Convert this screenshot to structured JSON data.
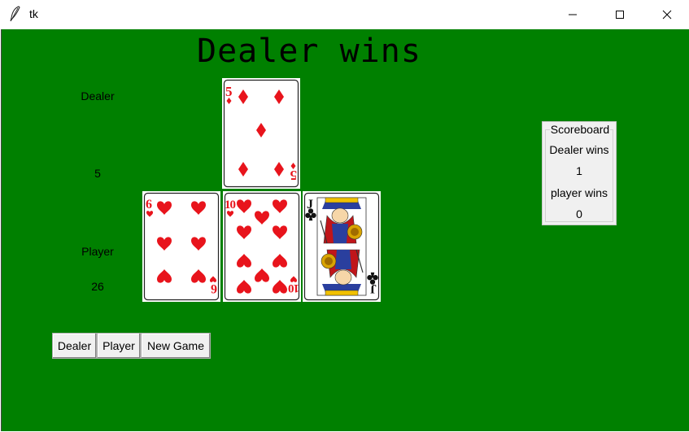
{
  "window": {
    "title": "tk"
  },
  "result_text": "Dealer wins",
  "labels": {
    "dealer": "Dealer",
    "dealer_score": "5",
    "player": "Player",
    "player_score": "26"
  },
  "buttons": {
    "dealer": "Dealer",
    "player": "Player",
    "new_game": "New Game"
  },
  "scoreboard": {
    "title": "Scoreboard",
    "dealer_label": "Dealer wins",
    "dealer_wins": "1",
    "player_label": "player wins",
    "player_wins": "0"
  },
  "cards": {
    "dealer": [
      {
        "rank": "5",
        "suit": "diamonds"
      }
    ],
    "player": [
      {
        "rank": "6",
        "suit": "hearts"
      },
      {
        "rank": "10",
        "suit": "hearts"
      },
      {
        "rank": "J",
        "suit": "clubs"
      }
    ]
  },
  "colors": {
    "table": "#008000",
    "card_red": "#e8141c"
  }
}
